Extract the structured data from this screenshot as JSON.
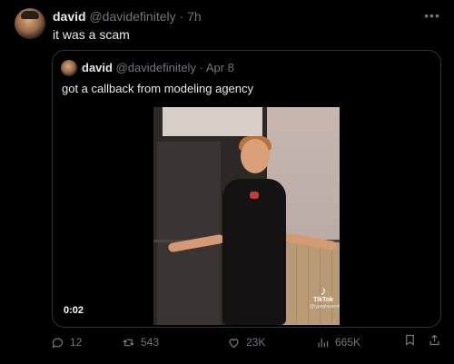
{
  "tweet": {
    "author_name": "david",
    "author_handle": "@davidefinitely",
    "separator": "·",
    "time": "7h",
    "text": "it was a scam",
    "more_icon": "more-horizontal-icon"
  },
  "quoted": {
    "author_name": "david",
    "author_handle": "@davidefinitely",
    "separator": "·",
    "date": "Apr 8",
    "text": "got a callback from modeling agency",
    "video": {
      "duration": "0:02",
      "watermark_label": "TikTok",
      "watermark_user": "@typeplayerofficial"
    }
  },
  "actions": {
    "reply": {
      "icon": "reply-icon",
      "count": "12"
    },
    "retweet": {
      "icon": "retweet-icon",
      "count": "543"
    },
    "like": {
      "icon": "heart-icon",
      "count": "23K"
    },
    "views": {
      "icon": "views-icon",
      "count": "665K"
    },
    "bookmark": {
      "icon": "bookmark-icon"
    },
    "share": {
      "icon": "share-icon"
    }
  },
  "colors": {
    "background": "#000000",
    "text": "#e7e9ea",
    "secondary": "#71767b",
    "border": "#2f3336"
  }
}
